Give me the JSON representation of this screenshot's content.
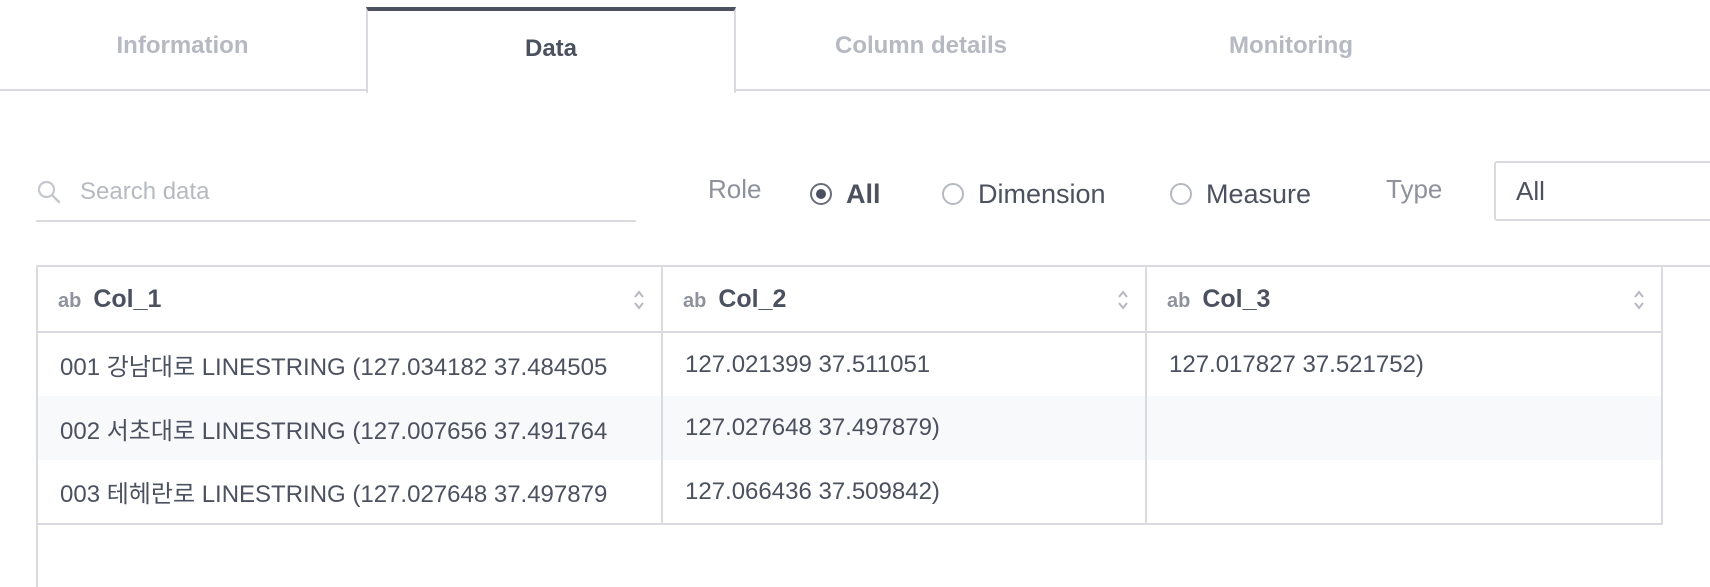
{
  "tabs": [
    {
      "label": "Information",
      "active": false
    },
    {
      "label": "Data",
      "active": true
    },
    {
      "label": "Column details",
      "active": false
    },
    {
      "label": "Monitoring",
      "active": false
    }
  ],
  "search": {
    "placeholder": "Search data",
    "value": "",
    "icon": "search-icon"
  },
  "filters": {
    "role_label": "Role",
    "role_options": [
      "All",
      "Dimension",
      "Measure"
    ],
    "role_selected": "All",
    "type_label": "Type",
    "type_selected": "All"
  },
  "table": {
    "type_badge": "ab",
    "columns": [
      "Col_1",
      "Col_2",
      "Col_3"
    ],
    "rows": [
      [
        "001 강남대로 LINESTRING (127.034182 37.484505",
        "127.021399 37.511051",
        "127.017827 37.521752)"
      ],
      [
        "002 서초대로 LINESTRING (127.007656 37.491764",
        "127.027648 37.497879)",
        ""
      ],
      [
        "003 테헤란로 LINESTRING (127.027648 37.497879",
        "127.066436 37.509842)",
        ""
      ]
    ]
  },
  "colors": {
    "text": "#4b515f",
    "muted": "#b6b9c2",
    "border": "#d9dbe0",
    "accent": "#4b515f"
  }
}
